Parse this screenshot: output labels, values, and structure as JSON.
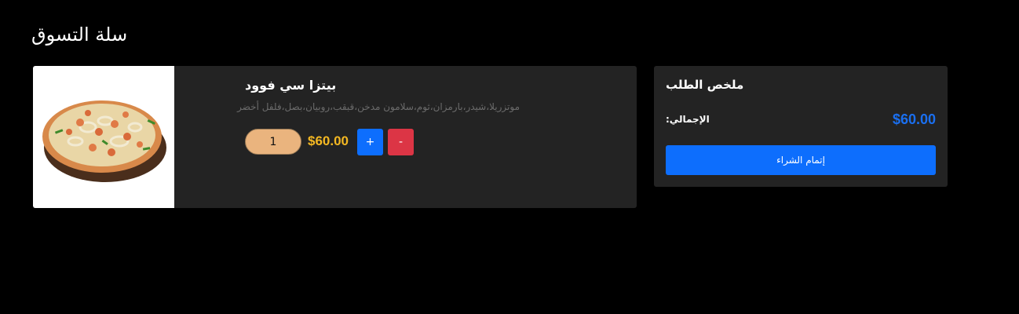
{
  "page": {
    "title": "سلة التسوق"
  },
  "cart": {
    "items": [
      {
        "name": "بيتزا سي فوود",
        "description": "موتزريلا،شيدر،بارمزان،ثوم،سلامون مدخن،قبقب،روبيان،بصل،فلفل أخضر",
        "quantity": "1",
        "price": "$60.00",
        "increase_label": "+",
        "decrease_label": "-",
        "image_icon": "pizza-image"
      }
    ]
  },
  "summary": {
    "title": "ملخص الطلب",
    "total_label": "الإجمالي:",
    "total_value": "$60.00",
    "checkout_label": "إتمام الشراء"
  },
  "colors": {
    "background": "#000000",
    "card": "#232323",
    "price": "#f4b822",
    "total": "#1a6ff0",
    "primary": "#0d6efd",
    "danger": "#dc3545",
    "quantity_field": "#eab47e"
  }
}
